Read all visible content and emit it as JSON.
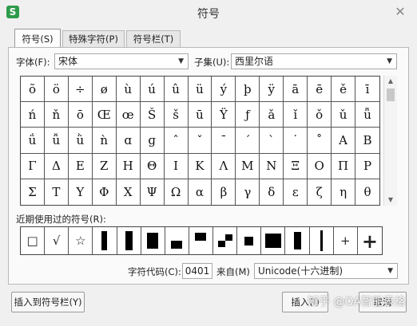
{
  "window": {
    "icon_letter": "S",
    "title": "符号",
    "close": "✕"
  },
  "tabs": [
    {
      "label": "符号(S)",
      "active": true
    },
    {
      "label": "特殊字符(P)",
      "active": false
    },
    {
      "label": "符号栏(T)",
      "active": false
    }
  ],
  "font": {
    "label": "字体(F):",
    "value": "宋体"
  },
  "subset": {
    "label": "子集(U):",
    "value": "西里尔语"
  },
  "symbols": [
    "õ",
    "ö",
    "÷",
    "ø",
    "ù",
    "ú",
    "û",
    "ü",
    "ý",
    "þ",
    "ÿ",
    "ā",
    "ē",
    "ě",
    "ī",
    "ń",
    "ň",
    "ō",
    "Œ",
    "œ",
    "Š",
    "š",
    "ū",
    "Ÿ",
    "ƒ",
    "ǎ",
    "ǐ",
    "ǒ",
    "ǔ",
    "ǖ",
    "ǘ",
    "ǚ",
    "ǜ",
    "ǹ",
    "ɑ",
    "ɡ",
    "ˆ",
    "ˇ",
    "ˉ",
    "ˊ",
    "ˋ",
    "˙",
    "˚",
    "Α",
    "Β",
    "Γ",
    "Δ",
    "Ε",
    "Ζ",
    "Η",
    "Θ",
    "Ι",
    "Κ",
    "Λ",
    "Μ",
    "Ν",
    "Ξ",
    "Ο",
    "Π",
    "Ρ",
    "Σ",
    "Τ",
    "Υ",
    "Φ",
    "Χ",
    "Ψ",
    "Ω",
    "α",
    "β",
    "γ",
    "δ",
    "ε",
    "ζ",
    "η",
    "θ"
  ],
  "recent": {
    "label": "近期使用过的符号(R):",
    "items": [
      {
        "t": "□"
      },
      {
        "t": "√"
      },
      {
        "t": "☆"
      },
      {
        "t": "",
        "shape": "bar-thin"
      },
      {
        "t": "",
        "shape": "bar-wide"
      },
      {
        "t": "",
        "shape": "block-tall"
      },
      {
        "t": "",
        "shape": "block-low"
      },
      {
        "t": "",
        "shape": "block-top"
      },
      {
        "t": "",
        "shape": "steps"
      },
      {
        "t": "",
        "shape": "square-small"
      },
      {
        "t": "",
        "shape": "square-big"
      },
      {
        "t": "",
        "shape": "bar-medium"
      },
      {
        "t": "",
        "shape": "line-vertical"
      },
      {
        "t": "+"
      },
      {
        "t": "+",
        "bold": true
      }
    ]
  },
  "code": {
    "label": "字符代码(C):",
    "value": "0401"
  },
  "from": {
    "label": "来自(M)",
    "value": "Unicode(十六进制)"
  },
  "buttons": {
    "insert_to_bar": "插入到符号栏(Y)",
    "insert": "插入(I)",
    "cancel": "取消"
  },
  "watermark": "知乎 @OA智能表格"
}
